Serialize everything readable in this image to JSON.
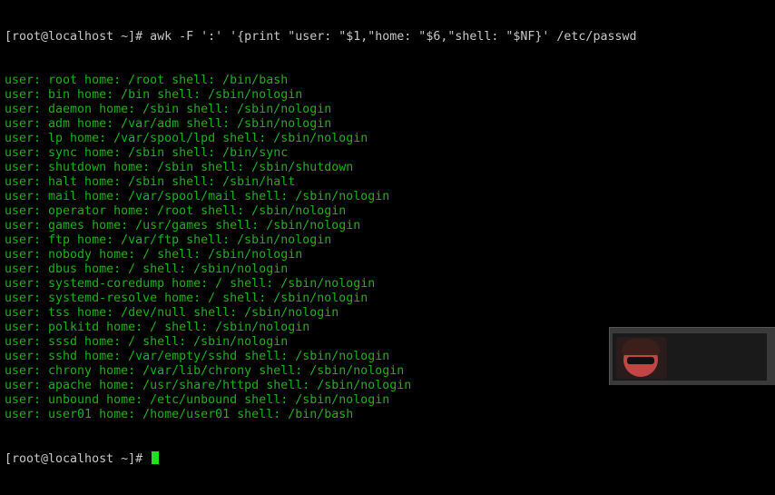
{
  "terminal": {
    "prompt_command": "[root@localhost ~]# awk -F ':' '{print \"user: \"$1,\"home: \"$6,\"shell: \"$NF}' /etc/passwd",
    "output_lines": [
      "user: root home: /root shell: /bin/bash",
      "user: bin home: /bin shell: /sbin/nologin",
      "user: daemon home: /sbin shell: /sbin/nologin",
      "user: adm home: /var/adm shell: /sbin/nologin",
      "user: lp home: /var/spool/lpd shell: /sbin/nologin",
      "user: sync home: /sbin shell: /bin/sync",
      "user: shutdown home: /sbin shell: /sbin/shutdown",
      "user: halt home: /sbin shell: /sbin/halt",
      "user: mail home: /var/spool/mail shell: /sbin/nologin",
      "user: operator home: /root shell: /sbin/nologin",
      "user: games home: /usr/games shell: /sbin/nologin",
      "user: ftp home: /var/ftp shell: /sbin/nologin",
      "user: nobody home: / shell: /sbin/nologin",
      "user: dbus home: / shell: /sbin/nologin",
      "user: systemd-coredump home: / shell: /sbin/nologin",
      "user: systemd-resolve home: / shell: /sbin/nologin",
      "user: tss home: /dev/null shell: /sbin/nologin",
      "user: polkitd home: / shell: /sbin/nologin",
      "user: sssd home: / shell: /sbin/nologin",
      "user: sshd home: /var/empty/sshd shell: /sbin/nologin",
      "user: chrony home: /var/lib/chrony shell: /sbin/nologin",
      "user: apache home: /usr/share/httpd shell: /sbin/nologin",
      "user: unbound home: /etc/unbound shell: /sbin/nologin",
      "user: user01 home: /home/user01 shell: /bin/bash"
    ],
    "final_prompt": "[root@localhost ~]#"
  },
  "colors": {
    "background": "#000000",
    "output_text": "#18b418",
    "prompt_text": "#c8c8c8",
    "cursor": "#19e619"
  },
  "overlay": {
    "icon": "webcam-avatar-icon"
  }
}
